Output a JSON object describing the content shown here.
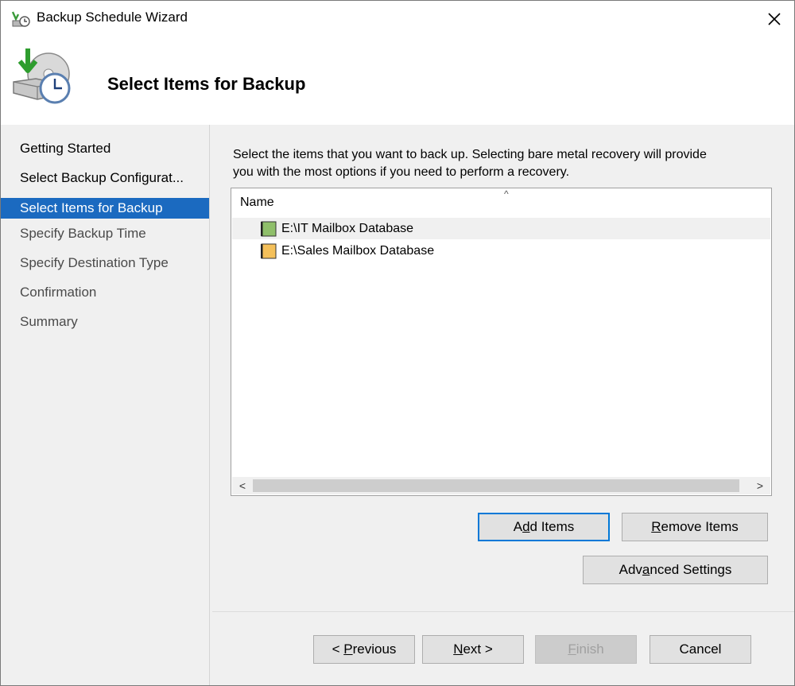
{
  "window": {
    "title": "Backup Schedule Wizard"
  },
  "header": {
    "title": "Select Items for Backup"
  },
  "nav": {
    "items": [
      {
        "label": "Getting Started",
        "state": "done"
      },
      {
        "label": "Select Backup Configurat...",
        "state": "done"
      },
      {
        "label": "Select Items for Backup",
        "state": "active"
      },
      {
        "label": "Specify Backup Time",
        "state": "todo"
      },
      {
        "label": "Specify Destination Type",
        "state": "todo"
      },
      {
        "label": "Confirmation",
        "state": "todo"
      },
      {
        "label": "Summary",
        "state": "todo"
      }
    ]
  },
  "content": {
    "instructions_line1": "Select the items that you want to back up. Selecting bare metal recovery will provide",
    "instructions_line2": "you with the most options if you need to perform a recovery.",
    "list": {
      "column_header": "Name",
      "sort_indicator": "^",
      "rows": [
        {
          "label": "E:\\IT Mailbox Database"
        },
        {
          "label": "E:\\Sales Mailbox Database"
        }
      ],
      "scroll_left": "<",
      "scroll_right": ">"
    },
    "buttons": {
      "add_items_pre": "A",
      "add_items_key": "d",
      "add_items_post": "d Items",
      "remove_items_key": "R",
      "remove_items_post": "emove Items",
      "advanced_pre": "Adv",
      "advanced_key": "a",
      "advanced_post": "nced Settings"
    }
  },
  "footer": {
    "previous_pre": "< ",
    "previous_key": "P",
    "previous_post": "revious",
    "next_key": "N",
    "next_post": "ext >",
    "finish_key": "F",
    "finish_post": "inish",
    "cancel_label": "Cancel"
  },
  "colors": {
    "accent": "#1b6ac0",
    "default_button_border": "#0078d7",
    "panel_bg": "#f0f0f0"
  }
}
